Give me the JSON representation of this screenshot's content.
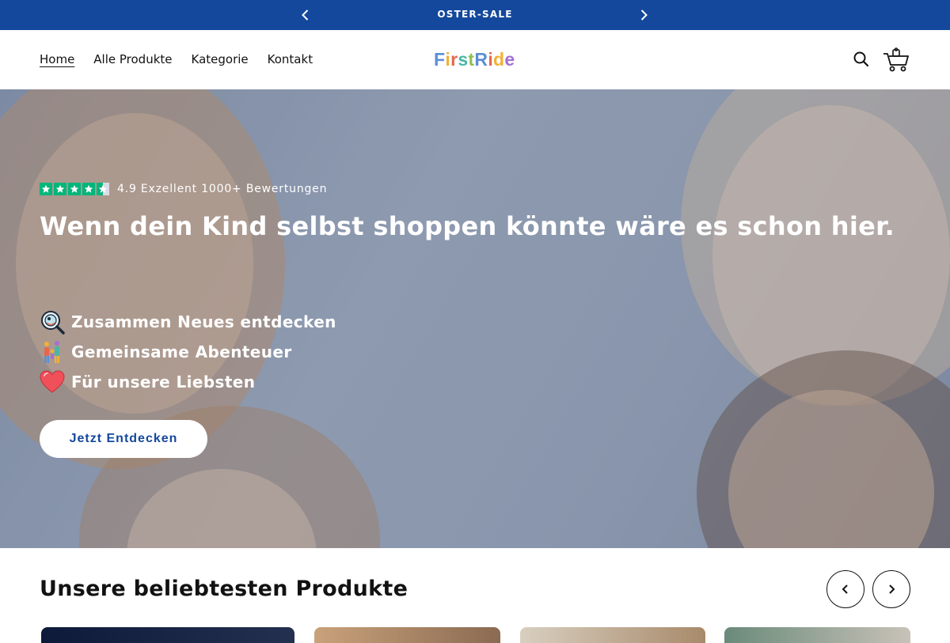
{
  "announcement": {
    "text": "OSTER-SALE"
  },
  "nav": {
    "items": [
      {
        "label": "Home",
        "active": true
      },
      {
        "label": "Alle Produkte",
        "active": false
      },
      {
        "label": "Kategorie",
        "active": false
      },
      {
        "label": "Kontakt",
        "active": false
      }
    ]
  },
  "brand": {
    "name": "FirstRide",
    "letter_colors": [
      "#5b8fd6",
      "#f2b134",
      "#e8664c",
      "#4bb6a6",
      "#8cc152",
      "#5b8fd6",
      "#e8664c",
      "#f2b134",
      "#a56fd1"
    ]
  },
  "header_icons": {
    "search": "search-icon",
    "cart": "shopping-cart-icon"
  },
  "hero": {
    "rating": {
      "score": "4.9",
      "text": "4.9 Exzellent 1000+ Bewertungen",
      "stars": 4.5,
      "star_color": "#00b67a"
    },
    "title": "Wenn dein Kind selbst shoppen könnte wäre es schon hier.",
    "features": [
      {
        "icon": "magnifier-icon",
        "label": "Zusammen Neues entdecken"
      },
      {
        "icon": "family-icon",
        "label": "Gemeinsame Abenteuer"
      },
      {
        "icon": "heart-icon",
        "label": "Für unsere Liebsten"
      }
    ],
    "cta": "Jetzt Entdecken"
  },
  "products_section": {
    "title": "Unsere beliebtesten Produkte"
  },
  "colors": {
    "primary": "#14489c",
    "accent_green": "#00b67a",
    "heart": "#f0505a"
  }
}
